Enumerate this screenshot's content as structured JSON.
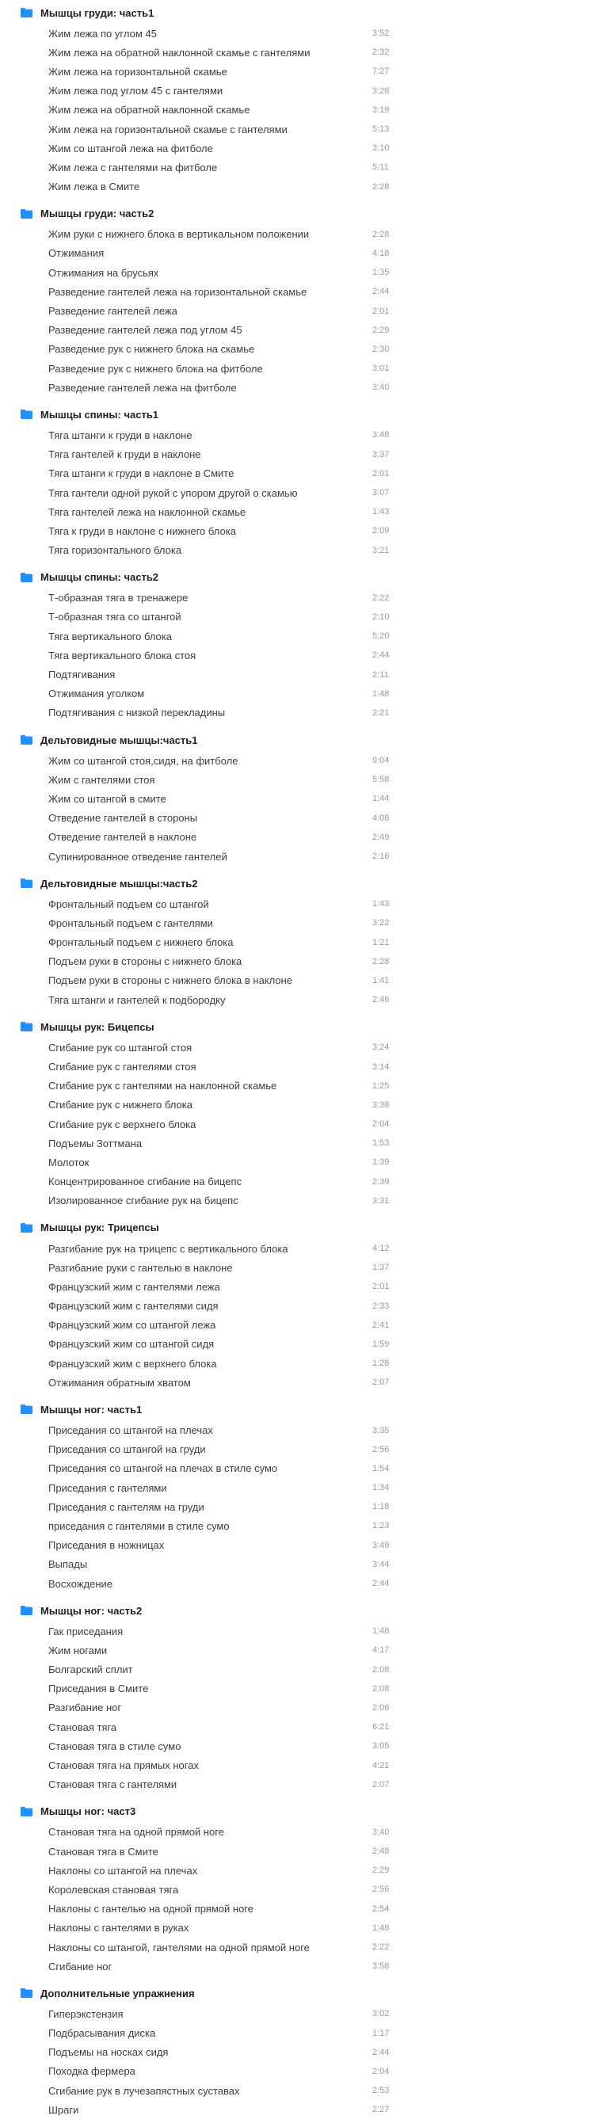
{
  "sections": [
    {
      "title": "Мышцы груди: часть1",
      "items": [
        {
          "title": "Жим лежа по углом 45",
          "duration": "3:52"
        },
        {
          "title": "Жим лежа на обратной наклонной скамье с гантелями",
          "duration": "2:32"
        },
        {
          "title": "Жим лежа на горизонтальной скамье",
          "duration": "7:27"
        },
        {
          "title": "Жим лежа под углом 45 с гантелями",
          "duration": "3:28"
        },
        {
          "title": "Жим лежа на обратной наклонной скамье",
          "duration": "3:19"
        },
        {
          "title": "Жим лежа на горизонтальной скамье с гантелями",
          "duration": "5:13"
        },
        {
          "title": "Жим со штангой лежа на фитболе",
          "duration": "3:10"
        },
        {
          "title": "Жим лежа с гантелями на фитболе",
          "duration": "5:11"
        },
        {
          "title": "Жим лежа в Смите",
          "duration": "2:28"
        }
      ]
    },
    {
      "title": "Мышцы груди: часть2",
      "items": [
        {
          "title": "Жим руки с нижнего блока в вертикальном положении",
          "duration": "2:28"
        },
        {
          "title": "Отжимания",
          "duration": "4:18"
        },
        {
          "title": "Отжимания на брусьях",
          "duration": "1:35"
        },
        {
          "title": "Разведение гантелей лежа на горизонтальной скамье",
          "duration": "2:44"
        },
        {
          "title": "Разведение гантелей лежа",
          "duration": "2:01"
        },
        {
          "title": "Разведение гантелей лежа под углом 45",
          "duration": "2:29"
        },
        {
          "title": "Разведение рук с нижнего блока на скамье",
          "duration": "2:30"
        },
        {
          "title": "Разведение рук с нижнего блока на фитболе",
          "duration": "3:01"
        },
        {
          "title": "Разведение гантелей лежа на фитболе",
          "duration": "3:40"
        }
      ]
    },
    {
      "title": "Мышцы спины: часть1",
      "items": [
        {
          "title": "Тяга штанги к груди в наклоне",
          "duration": "3:48"
        },
        {
          "title": "Тяга гантелей к груди в наклоне",
          "duration": "3:37"
        },
        {
          "title": "Тяга штанги к груди в наклоне в Смите",
          "duration": "2:01"
        },
        {
          "title": "Тяга гантели одной рукой с упором другой о скамью",
          "duration": "3:07"
        },
        {
          "title": "Тяга гантелей лежа на наклонной скамье",
          "duration": "1:43"
        },
        {
          "title": "Тяга к груди в наклоне с нижнего блока",
          "duration": "2:09"
        },
        {
          "title": "Тяга горизонтального блока",
          "duration": "3:21"
        }
      ]
    },
    {
      "title": "Мышцы спины: часть2",
      "items": [
        {
          "title": "Т-образная тяга в тренажере",
          "duration": "2:22"
        },
        {
          "title": "Т-образная тяга со штангой",
          "duration": "2:10"
        },
        {
          "title": "Тяга вертикального блока",
          "duration": "5:20"
        },
        {
          "title": "Тяга вертикального блока стоя",
          "duration": "2:44"
        },
        {
          "title": "Подтягивания",
          "duration": "2:11"
        },
        {
          "title": "Отжимания уголком",
          "duration": "1:48"
        },
        {
          "title": "Подтягивания с низкой перекладины",
          "duration": "2:21"
        }
      ]
    },
    {
      "title": "Дельтовидные мышцы:часть1",
      "items": [
        {
          "title": "Жим со штангой стоя,сидя, на фитболе",
          "duration": "9:04"
        },
        {
          "title": "Жим с гантелями стоя",
          "duration": "5:58"
        },
        {
          "title": "Жим со штангой в смите",
          "duration": "1:44"
        },
        {
          "title": "Отведение гантелей в стороны",
          "duration": "4:08"
        },
        {
          "title": "Отведение гантелей в наклоне",
          "duration": "2:49"
        },
        {
          "title": "Супинированное отведение гантелей",
          "duration": "2:16"
        }
      ]
    },
    {
      "title": "Дельтовидные мышцы:часть2",
      "items": [
        {
          "title": "Фронтальный подъем со штангой",
          "duration": "1:43"
        },
        {
          "title": "Фронтальный подъем с гантелями",
          "duration": "3:22"
        },
        {
          "title": "Фронтальный подъем с нижнего блока",
          "duration": "1:21"
        },
        {
          "title": "Подъем руки в стороны с нижнего блока",
          "duration": "2:28"
        },
        {
          "title": "Подъем руки в стороны с нижнего блока в наклоне",
          "duration": "1:41"
        },
        {
          "title": "Тяга штанги и гантелей к подбородку",
          "duration": "2:46"
        }
      ]
    },
    {
      "title": "Мышцы рук: Бицепсы",
      "items": [
        {
          "title": "Сгибание рук со штангой стоя",
          "duration": "3:24"
        },
        {
          "title": "Сгибание рук с гантелями стоя",
          "duration": "3:14"
        },
        {
          "title": "Сгибание рук с гантелями на наклонной скамье",
          "duration": "1:25"
        },
        {
          "title": "Сгибание рук с нижнего блока",
          "duration": "3:38"
        },
        {
          "title": "Сгибание рук с верхнего блока",
          "duration": "2:04"
        },
        {
          "title": "Подъемы Зоттмана",
          "duration": "1:53"
        },
        {
          "title": "Молоток",
          "duration": "1:39"
        },
        {
          "title": "Концентрированное сгибание на бицепс",
          "duration": "2:39"
        },
        {
          "title": "Изолированное сгибание рук на бицепс",
          "duration": "3:31"
        }
      ]
    },
    {
      "title": "Мышцы рук: Трицепсы",
      "items": [
        {
          "title": "Разгибание рук на трицепс с вертикального блока",
          "duration": "4:12"
        },
        {
          "title": "Разгибание руки с гантелью в наклоне",
          "duration": "1:37"
        },
        {
          "title": "Французский жим с гантелями лежа",
          "duration": "2:01"
        },
        {
          "title": "Французский жим с гантелями сидя",
          "duration": "2:33"
        },
        {
          "title": "Французский жим со штангой лежа",
          "duration": "2:41"
        },
        {
          "title": "Французский жим со штангой сидя",
          "duration": "1:59"
        },
        {
          "title": "Французский жим с верхнего блока",
          "duration": "1:28"
        },
        {
          "title": "Отжимания обратным хватом",
          "duration": "2:07"
        }
      ]
    },
    {
      "title": "Мышцы ног: часть1",
      "items": [
        {
          "title": "Приседания со штангой на плечах",
          "duration": "3:35"
        },
        {
          "title": "Приседания со штангой на груди",
          "duration": "2:56"
        },
        {
          "title": "Приседания со штангой на плечах в стиле сумо",
          "duration": "1:54"
        },
        {
          "title": "Приседания с гантелями",
          "duration": "1:34"
        },
        {
          "title": "Приседания с гантелям на груди",
          "duration": "1:18"
        },
        {
          "title": "приседания с гантелями в стиле сумо",
          "duration": "1:23"
        },
        {
          "title": "Приседания в ножницах",
          "duration": "3:49"
        },
        {
          "title": "Выпады",
          "duration": "3:44"
        },
        {
          "title": "Восхождение",
          "duration": "2:44"
        }
      ]
    },
    {
      "title": "Мышцы ног: часть2",
      "items": [
        {
          "title": "Гак приседания",
          "duration": "1:48"
        },
        {
          "title": "Жим ногами",
          "duration": "4:17"
        },
        {
          "title": "Болгарский сплит",
          "duration": "2:08"
        },
        {
          "title": "Приседания в Смите",
          "duration": "2:08"
        },
        {
          "title": "Разгибание ног",
          "duration": "2:06"
        },
        {
          "title": "Становая тяга",
          "duration": "6:21"
        },
        {
          "title": "Становая тяга в стиле сумо",
          "duration": "3:05"
        },
        {
          "title": "Становая тяга на прямых ногах",
          "duration": "4:21"
        },
        {
          "title": "Становая тяга с гантелями",
          "duration": "2:07"
        }
      ]
    },
    {
      "title": "Мышцы ног: част3",
      "items": [
        {
          "title": "Становая тяга на одной прямой ноге",
          "duration": "3:40"
        },
        {
          "title": "Становая тяга в Смите",
          "duration": "2:48"
        },
        {
          "title": "Наклоны со штангой на плечах",
          "duration": "2:29"
        },
        {
          "title": "Королевская становая тяга",
          "duration": "2:56"
        },
        {
          "title": "Наклоны с гантелью на одной прямой ноге",
          "duration": "2:54"
        },
        {
          "title": "Наклоны с гантелями в руках",
          "duration": "1:48"
        },
        {
          "title": "Наклоны со штангой, гантелями на одной прямой ноге",
          "duration": "2:22"
        },
        {
          "title": "Сгибание ног",
          "duration": "3:58"
        }
      ]
    },
    {
      "title": "Дополнительные упражнения",
      "items": [
        {
          "title": "Гиперэкстензия",
          "duration": "3:02"
        },
        {
          "title": "Подбрасывания диска",
          "duration": "1:17"
        },
        {
          "title": "Подъемы на носках сидя",
          "duration": "2:44"
        },
        {
          "title": "Походка фермера",
          "duration": "2:04"
        },
        {
          "title": "Сгибание рук в лучезапястных суставах",
          "duration": "2:53"
        },
        {
          "title": "Шраги",
          "duration": "2:27"
        }
      ]
    }
  ],
  "icon": "folder-icon",
  "colors": {
    "folder": "#1e90ff",
    "title": "#222222",
    "item": "#3d3d3d",
    "duration": "#9a9a9a"
  }
}
